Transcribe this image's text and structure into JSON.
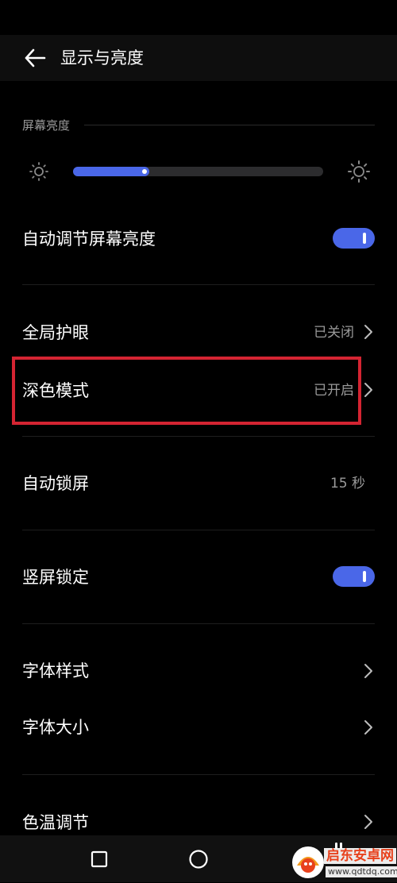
{
  "header": {
    "title": "显示与亮度",
    "back_icon": "arrow-left-icon"
  },
  "brightness": {
    "section_label": "屏幕亮度",
    "level_fraction": 0.305,
    "low_icon": "sun-dim-icon",
    "high_icon": "sun-bright-icon",
    "accent_color": "#4a67e8"
  },
  "settings": {
    "auto_brightness": {
      "label": "自动调节屏幕亮度",
      "enabled": true
    },
    "eye_comfort": {
      "label": "全局护眼",
      "value": "已关闭"
    },
    "dark_mode": {
      "label": "深色模式",
      "value": "已开启",
      "highlighted": true,
      "highlight_color": "#d42432"
    },
    "auto_lock": {
      "label": "自动锁屏",
      "value": "15 秒"
    },
    "portrait_lock": {
      "label": "竖屏锁定",
      "enabled": true
    },
    "font_style": {
      "label": "字体样式"
    },
    "font_size": {
      "label": "字体大小"
    },
    "color_temperature": {
      "label": "色温调节"
    }
  },
  "nav_bar": {
    "recent_icon": "square-icon",
    "home_icon": "circle-icon"
  },
  "watermark": {
    "brand": "启东安卓网",
    "url": "www.qdtdq.com",
    "brand_color": "#e8411c"
  }
}
